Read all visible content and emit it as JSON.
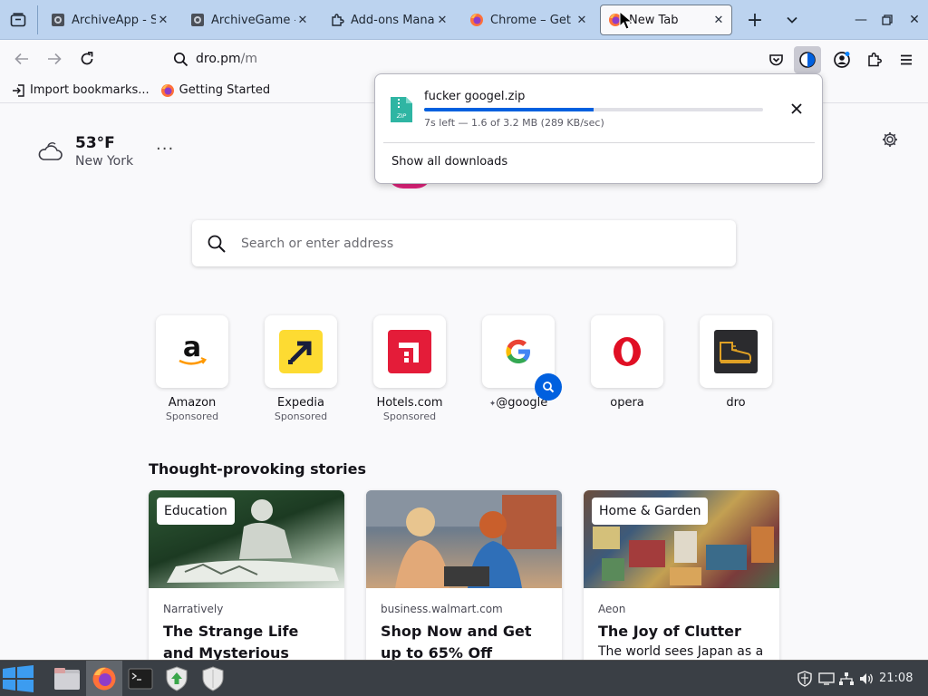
{
  "colors": {
    "tabstrip": "#bcd3ef",
    "accent": "#0060df",
    "taskbar": "#3a3f45"
  },
  "tabs": [
    {
      "title": "ArchiveApp - Sc",
      "icon": "archiveapp-icon",
      "active": false
    },
    {
      "title": "ArchiveGame - I",
      "icon": "archivegame-icon",
      "active": false
    },
    {
      "title": "Add-ons Manag",
      "icon": "puzzle-icon",
      "active": false
    },
    {
      "title": "Chrome – Get th",
      "icon": "firefox-icon",
      "active": false
    },
    {
      "title": "New Tab",
      "icon": "firefox-icon",
      "active": true
    }
  ],
  "urlbar": {
    "host": "dro.pm",
    "path": "/m"
  },
  "bookmarks": [
    {
      "label": "Import bookmarks...",
      "icon": "import-icon"
    },
    {
      "label": "Getting Started",
      "icon": "firefox-icon"
    }
  ],
  "weather": {
    "temp": "53°F",
    "city": "New York",
    "more": "···"
  },
  "search": {
    "placeholder": "Search or enter address"
  },
  "top_sites": [
    {
      "name": "Amazon",
      "sponsored": "Sponsored"
    },
    {
      "name": "Expedia",
      "sponsored": "Sponsored"
    },
    {
      "name": "Hotels.com",
      "sponsored": "Sponsored"
    },
    {
      "name": "@google",
      "sponsored": ""
    },
    {
      "name": "opera",
      "sponsored": ""
    },
    {
      "name": "dro",
      "sponsored": ""
    }
  ],
  "stories": {
    "title": "Thought-provoking stories",
    "cards": [
      {
        "tag": "Education",
        "source": "Narratively",
        "headline": "The Strange Life and Mysterious Death of a",
        "desc": ""
      },
      {
        "tag": "",
        "source": "business.walmart.com",
        "headline": "Shop Now and Get up to 65% Off",
        "desc": ""
      },
      {
        "tag": "Home & Garden",
        "source": "Aeon",
        "headline": "The Joy of Clutter",
        "desc": "The world sees Japan as a"
      }
    ]
  },
  "download": {
    "filename": "fucker googel.zip",
    "status": "7s left — 1.6 of 3.2 MB (289 KB/sec)",
    "progress": 0.5,
    "show_all": "Show all downloads"
  },
  "taskbar": {
    "clock": "21:08"
  }
}
